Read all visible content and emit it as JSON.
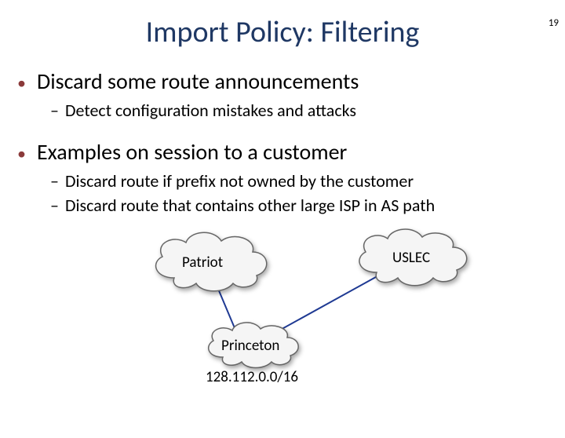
{
  "page_number": "19",
  "title": "Import Policy: Filtering",
  "bullets": [
    {
      "text": "Discard some route announcements",
      "subs": [
        "Detect configuration mistakes and attacks"
      ]
    },
    {
      "text": "Examples on session to a customer",
      "subs": [
        "Discard route if prefix not owned by the customer",
        "Discard route that contains other large ISP in AS path"
      ]
    }
  ],
  "diagram": {
    "left_cloud": "Patriot",
    "right_cloud": "USLEC",
    "bottom_cloud": "Princeton",
    "prefix": "128.112.0.0/16"
  }
}
